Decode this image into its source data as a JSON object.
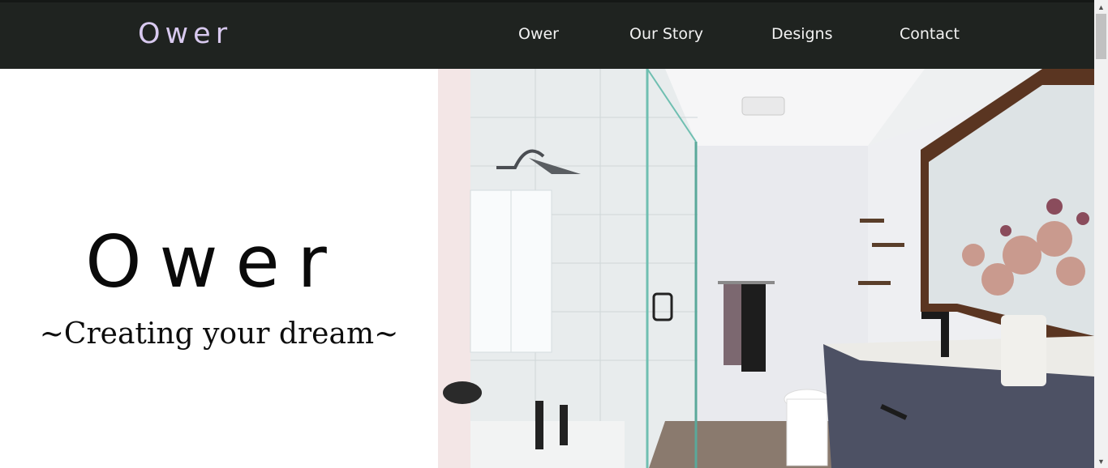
{
  "header": {
    "logo": "Ower",
    "nav": [
      "Ower",
      "Our Story",
      "Designs",
      "Contact"
    ]
  },
  "hero": {
    "title": "Ower",
    "subtitle": "~Creating your dream~"
  },
  "colors": {
    "header_bg": "#1f2320",
    "logo": "#d8c9ef",
    "nav_text": "#f2f2f2"
  },
  "icons": {
    "scroll_up": "chevron-up-icon",
    "scroll_down": "chevron-down-icon"
  }
}
